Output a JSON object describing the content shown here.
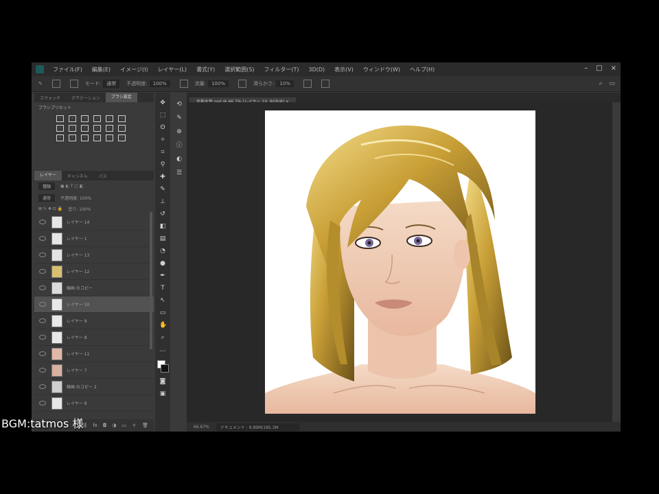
{
  "menubar": {
    "items": [
      "ファイル(F)",
      "編集(E)",
      "イメージ(I)",
      "レイヤー(L)",
      "書式(Y)",
      "選択範囲(S)",
      "フィルター(T)",
      "3D(D)",
      "表示(V)",
      "ウィンドウ(W)",
      "ヘルプ(H)"
    ],
    "controls": [
      "–",
      "□",
      "×"
    ]
  },
  "options_bar": {
    "mode_label": "モード:",
    "mode_value": "通常",
    "opacity_label": "不透明度:",
    "opacity_value": "100%",
    "flow_label": "流量:",
    "flow_value": "100%",
    "smoothing_label": "滑らかさ:",
    "smoothing_value": "10%"
  },
  "left_panel": {
    "tabs": [
      "スウォッチ",
      "グラデーション",
      "ブラシ設定"
    ],
    "presets_title": "ブラシプリセット",
    "layers_tabs": [
      "レイヤー",
      "チャンネル",
      "パス"
    ],
    "kind_label": "種類",
    "blend_mode": "通常",
    "opacity_label": "不透明度: 100%",
    "fill_label": "塗り: 100%",
    "layers": [
      {
        "name": "レイヤー 14",
        "thumb": "#e6e6e6",
        "selected": false
      },
      {
        "name": "レイヤー 1",
        "thumb": "#e6e6e6",
        "selected": false
      },
      {
        "name": "レイヤー 13",
        "thumb": "#e2e2e2",
        "selected": false
      },
      {
        "name": "レイヤー 12",
        "thumb": "#d8c070",
        "selected": false
      },
      {
        "name": "線画 のコピー",
        "thumb": "#dcdcdc",
        "selected": false
      },
      {
        "name": "レイヤー 10",
        "thumb": "#e8e8e8",
        "selected": true
      },
      {
        "name": "レイヤー 9",
        "thumb": "#e8e8e8",
        "selected": false
      },
      {
        "name": "レイヤー 8",
        "thumb": "#e8e8e8",
        "selected": false
      },
      {
        "name": "レイヤー 11",
        "thumb": "#e0b8a8",
        "selected": false
      },
      {
        "name": "レイヤー 7",
        "thumb": "#d8b0a0",
        "selected": false
      },
      {
        "name": "線画 のコピー 2",
        "thumb": "#cfcfcf",
        "selected": false
      },
      {
        "name": "レイヤー 6",
        "thumb": "#e6e6e6",
        "selected": false
      }
    ]
  },
  "document": {
    "tab_label": "金髪女性.psd @ 66.7% (レイヤー 10, RGB/8) ×",
    "zoom": "66.67%",
    "doc_info": "ドキュメント : 9.89M/185.3M"
  },
  "overlay": {
    "bgm_credit": "BGM:tatmos 様"
  },
  "colors": {
    "hair": "#d9b64a",
    "skin": "#f2d3bd",
    "eye": "#7a6aa0",
    "lip": "#c98a78"
  }
}
